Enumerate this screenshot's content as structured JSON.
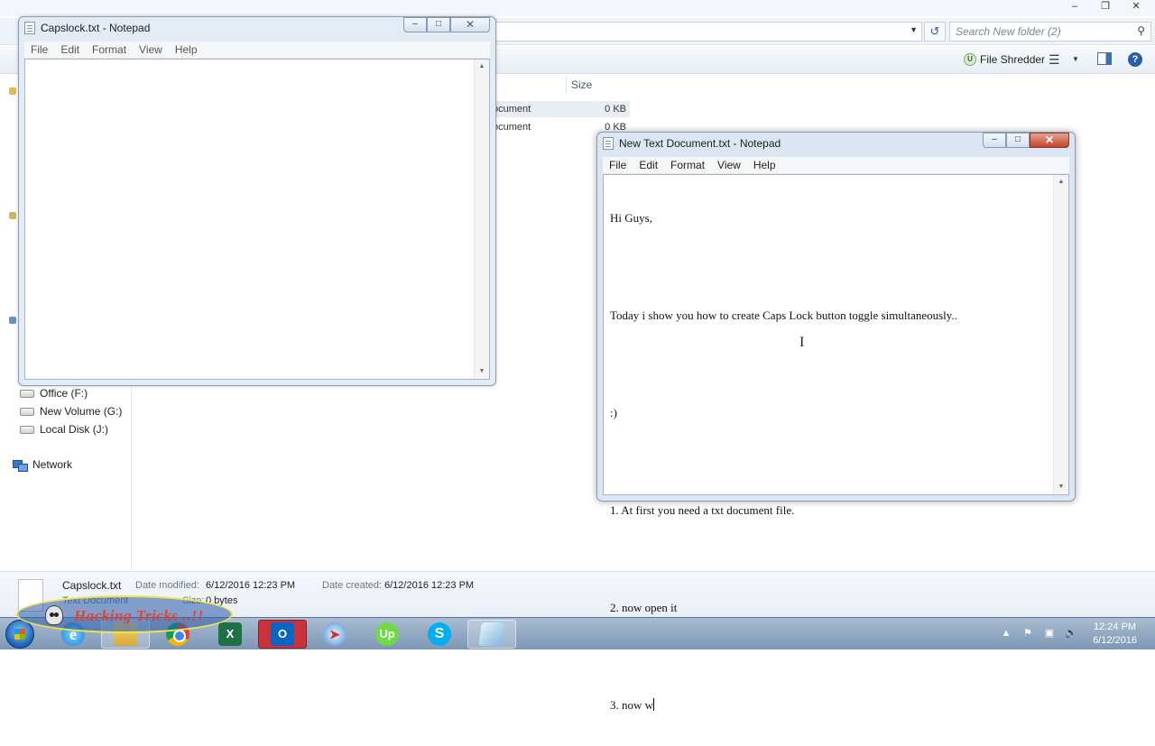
{
  "explorer": {
    "search_placeholder": "Search New folder (2)",
    "toolbar": {
      "file_shredder": "File Shredder",
      "help": "?"
    },
    "columns": {
      "size": "Size"
    },
    "rows": [
      {
        "type": "ocument",
        "size": "0 KB"
      },
      {
        "type": "ocument",
        "size": "0 KB"
      }
    ],
    "nav": [
      {
        "label": "Office (F:)"
      },
      {
        "label": "New Volume (G:)"
      },
      {
        "label": "Local Disk (J:)"
      },
      {
        "label": "Network"
      }
    ],
    "details": {
      "name": "Capslock.txt",
      "type": "Text Document",
      "date_modified_label": "Date modified:",
      "date_modified_value": "6/12/2016 12:23 PM",
      "date_created_label": "Date created:",
      "date_created_value": "6/12/2016 12:23 PM",
      "size_label": "Size:",
      "size_value": "0 bytes"
    }
  },
  "notepad_back": {
    "title": "Capslock.txt - Notepad",
    "menu": [
      "File",
      "Edit",
      "Format",
      "View",
      "Help"
    ]
  },
  "notepad_front": {
    "title": "New Text Document.txt - Notepad",
    "menu": [
      "File",
      "Edit",
      "Format",
      "View",
      "Help"
    ],
    "lines": [
      "Hi Guys,",
      "",
      "Today i show you how to create Caps Lock button toggle simultaneously..",
      "",
      ":)",
      "",
      "1. At first you need a txt document file.",
      "",
      "2. now open it",
      "",
      "3. now w"
    ]
  },
  "watermark": {
    "text": "Hacking Tricks ..!!"
  },
  "taskbar": {
    "excel_glyph": "X",
    "outlook_glyph": "O",
    "upwork_glyph": "Up",
    "skype_glyph": "S",
    "ie_glyph": "e",
    "time": "12:24 PM",
    "date": "6/12/2016"
  }
}
